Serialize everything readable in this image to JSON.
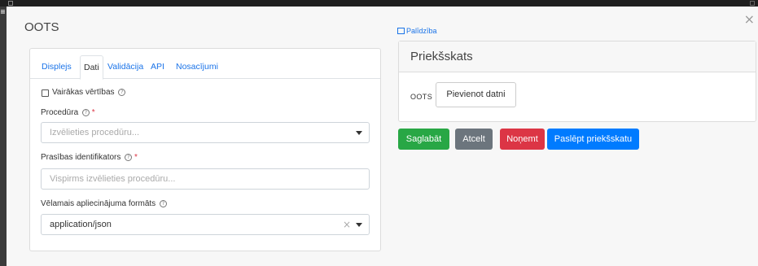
{
  "modal": {
    "title": "OOTS",
    "close_glyph": "×",
    "help_link": "Palīdzība"
  },
  "tabs": [
    {
      "label": "Displejs",
      "active": false
    },
    {
      "label": "Dati",
      "active": true
    },
    {
      "label": "Validācija",
      "active": false
    },
    {
      "label": "API",
      "active": false
    },
    {
      "label": "Nosacījumi",
      "active": false
    }
  ],
  "form": {
    "multiple_values_label": "Vairākas vērtības",
    "procedure_label": "Procedūra",
    "procedure_placeholder": "Izvēlieties procedūru...",
    "requirement_id_label": "Prasības identifikators",
    "requirement_id_placeholder": "Vispirms izvēlieties procedūru...",
    "format_label": "Vēlamais apliecinājuma formāts",
    "format_value": "application/json",
    "required_mark": "*",
    "help_glyph": "?"
  },
  "preview": {
    "title": "Priekšskats",
    "field_label": "OOTS",
    "add_file_button": "Pievienot datni"
  },
  "buttons": {
    "save": "Saglabāt",
    "cancel": "Atcelt",
    "remove": "Noņemt",
    "hide_preview": "Paslēpt priekšskatu"
  },
  "colors": {
    "save": "#28a745",
    "cancel": "#6c757d",
    "remove": "#dc3545",
    "hide_preview": "#007bff",
    "link": "#1a73e8"
  }
}
